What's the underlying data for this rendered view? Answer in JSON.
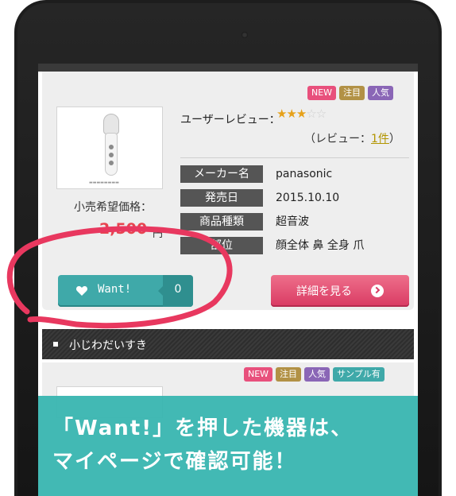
{
  "card1": {
    "badges": [
      "NEW",
      "注目",
      "人気"
    ],
    "badge_colors": [
      "#e8507c",
      "#b29145",
      "#8a66b6"
    ],
    "review_label": "ユーザーレビュー：",
    "stars_on": "★★★",
    "stars_off": "☆☆",
    "rating": 3,
    "review_prefix": "（レビュー：",
    "review_count": "1件",
    "review_suffix": "）",
    "price_label": "小売希望価格：",
    "price": "2,500",
    "price_unit": "円",
    "specs": [
      {
        "key": "メーカー名",
        "value": "panasonic"
      },
      {
        "key": "発売日",
        "value": "2015.10.10"
      },
      {
        "key": "商品種類",
        "value": "超音波"
      },
      {
        "key": "部位",
        "value": "顔全体 鼻 全身 爪"
      }
    ],
    "want_label": "Want!",
    "want_count": "0",
    "detail_label": "詳細を見る"
  },
  "section": {
    "title": "小じわだいすき"
  },
  "card2": {
    "badges": [
      "NEW",
      "注目",
      "人気",
      "サンプル有"
    ],
    "badge_colors": [
      "#e8507c",
      "#b29145",
      "#8a66b6",
      "#3fa9a9"
    ]
  },
  "banner": {
    "line1": "「Want!」を押した機器は、",
    "line2": "マイページで確認可能！"
  },
  "colors": {
    "accent_teal": "#3fa9a9",
    "accent_pink": "#e04a6e",
    "price_red": "#e8434f",
    "annotation_pink": "#e8385f"
  }
}
